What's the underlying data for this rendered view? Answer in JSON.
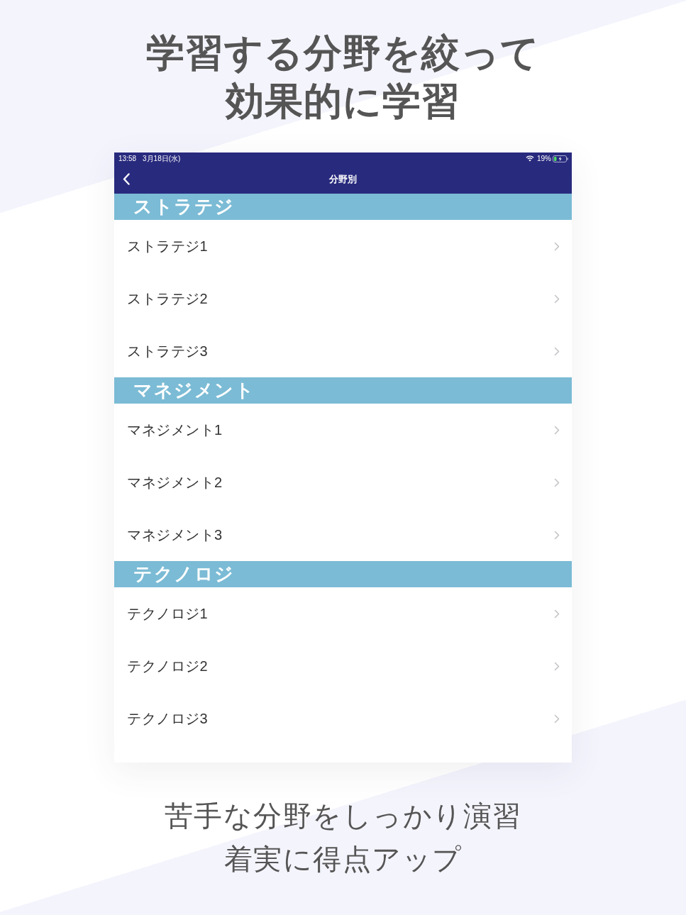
{
  "headline": {
    "lines": [
      "学習する分野を絞って",
      "効果的に学習"
    ]
  },
  "status_bar": {
    "time": "13:58",
    "date": "3月18日(水)",
    "battery": "19%",
    "charging": true
  },
  "nav_bar": {
    "title": "分野別"
  },
  "sections": [
    {
      "title": "ストラテジ",
      "items": [
        {
          "label": "ストラテジ1"
        },
        {
          "label": "ストラテジ2"
        },
        {
          "label": "ストラテジ3"
        }
      ]
    },
    {
      "title": "マネジメント",
      "items": [
        {
          "label": "マネジメント1"
        },
        {
          "label": "マネジメント2"
        },
        {
          "label": "マネジメント3"
        }
      ]
    },
    {
      "title": "テクノロジ",
      "items": [
        {
          "label": "テクノロジ1"
        },
        {
          "label": "テクノロジ2"
        },
        {
          "label": "テクノロジ3"
        }
      ]
    }
  ],
  "footer": {
    "lines": [
      "苦手な分野をしっかり演習",
      "着実に得点アップ"
    ]
  }
}
